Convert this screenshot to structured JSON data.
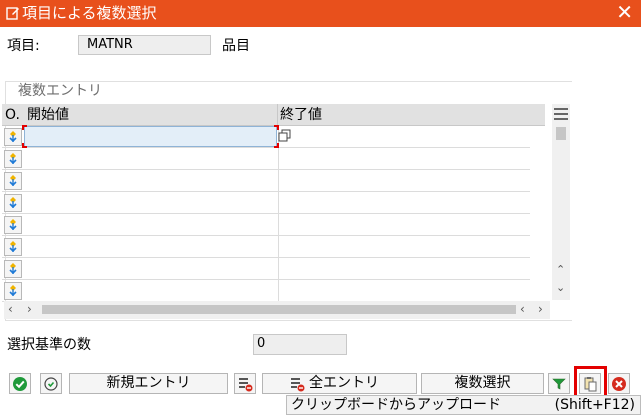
{
  "window": {
    "title": "項目による複数選択",
    "close_glyph": "✕"
  },
  "item": {
    "label": "項目:",
    "value": "MATNR",
    "description": "品目"
  },
  "panel": {
    "title": "複数エントリ"
  },
  "table": {
    "columns": [
      "O.",
      "開始値",
      "終了値"
    ],
    "row_count": 8,
    "rows": [
      {
        "start": "",
        "end": ""
      },
      {
        "start": "",
        "end": ""
      },
      {
        "start": "",
        "end": ""
      },
      {
        "start": "",
        "end": ""
      },
      {
        "start": "",
        "end": ""
      },
      {
        "start": "",
        "end": ""
      },
      {
        "start": "",
        "end": ""
      },
      {
        "start": "",
        "end": ""
      }
    ]
  },
  "selection_count": {
    "label": "選択基準の数",
    "value": "0"
  },
  "buttons": {
    "new_entries": "新規エントリ",
    "all_entries": "全エントリ",
    "multiple_selection": "複数選択"
  },
  "tooltip": {
    "text": "クリップボードからアップロード",
    "shortcut": "(Shift+F12)"
  },
  "icons": {
    "title": "edit-icon",
    "row_select": "diamond-icon",
    "copy_cell": "copy-icon",
    "confirm": "check-icon",
    "check_entries": "recheck-icon",
    "delete_row": "delete-row-icon",
    "delete_all": "delete-all-icon",
    "filter": "filter-icon",
    "clipboard": "clipboard-upload-icon",
    "cancel": "cancel-icon",
    "column_settings": "column-settings-icon"
  },
  "colors": {
    "titlebar": "#e8501c",
    "active_cell": "#e3eef8",
    "confirm_green": "#1f9a3a",
    "cancel_red": "#d52b1e",
    "highlight_red": "#e30000"
  }
}
